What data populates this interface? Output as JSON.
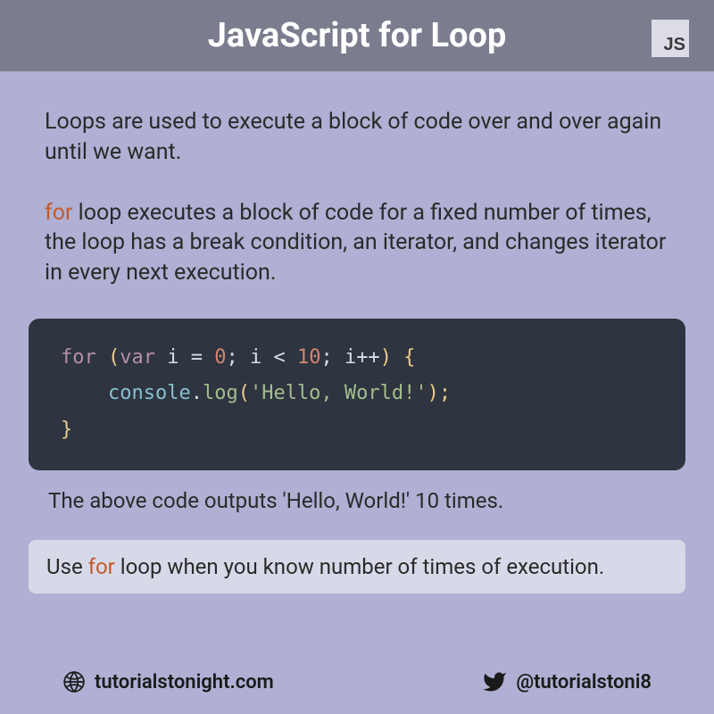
{
  "header": {
    "title": "JavaScript for Loop",
    "badge": "JS"
  },
  "para1": "Loops are used to execute a block of code over and over again until we want.",
  "para2_kw": "for",
  "para2_rest": " loop executes a block of code for a fixed number of times, the loop has a break condition, an iterator, and changes iterator in every next execution.",
  "code": {
    "l1_kw": "for ",
    "l1_br1": "(",
    "l1_var": "var",
    "l1_mid1": " i = ",
    "l1_n0": "0",
    "l1_semi1": "; i < ",
    "l1_n10": "10",
    "l1_semi2": "; i++",
    "l1_br2": ") {",
    "l2_obj": "    console",
    "l2_dot": ".",
    "l2_fn": "log",
    "l2_p1": "(",
    "l2_str": "'Hello, World!'",
    "l2_p2": ");",
    "l3": "}"
  },
  "output_note": "The above code outputs  'Hello, World!' 10 times.",
  "tip_pre": "Use ",
  "tip_kw": "for",
  "tip_post": " loop when you know number of times of execution.",
  "footer": {
    "site": "tutorialstonight.com",
    "handle": "@tutorialstoni8"
  }
}
